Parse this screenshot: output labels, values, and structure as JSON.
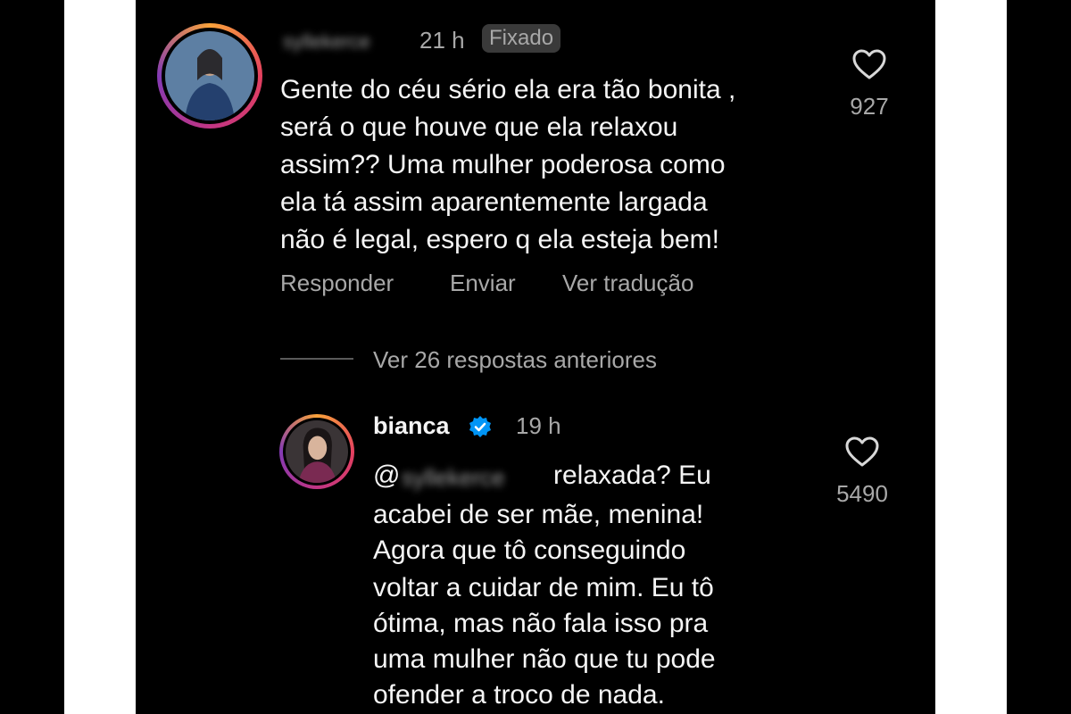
{
  "pinned_comment": {
    "username": "syllekerce",
    "time": "21 h",
    "pinned_label": "Fixado",
    "text_lines": [
      "Gente do céu sério ela era tão bonita ,",
      "será o que houve que ela relaxou",
      "assim?? Uma mulher poderosa como",
      "ela tá assim aparentemente largada",
      "não é legal, espero q ela esteja bem!"
    ],
    "like_count": "927",
    "actions": {
      "reply": "Responder",
      "send": "Enviar",
      "translate": "Ver tradução"
    }
  },
  "view_replies": {
    "label": "Ver 26 respostas anteriores"
  },
  "reply": {
    "username": "bianca",
    "time": "19 h",
    "mention_prefix": "@",
    "mention": "syllekerce",
    "text_lines": [
      "relaxada? Eu",
      "acabei de ser mãe, menina!",
      "Agora que tô conseguindo",
      "voltar a cuidar de mim. Eu tô",
      "ótima, mas não fala isso pra",
      "uma mulher não que tu pode",
      "ofender a troco de nada."
    ],
    "like_count": "5490"
  },
  "icons": {
    "heart": "heart-outline-icon",
    "verified": "verified-badge-icon"
  },
  "colors": {
    "background": "#000000",
    "text_primary": "#f5f5f5",
    "text_secondary": "#a8a8a8",
    "pinned_chip": "#3a3a3a",
    "verified_blue": "#0095f6"
  }
}
